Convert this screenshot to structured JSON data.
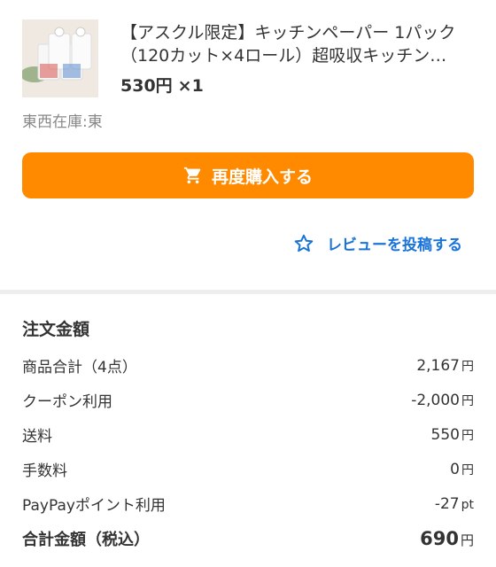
{
  "item": {
    "title_line1": "【アスクル限定】キッチンペーパー 1パック",
    "title_line2": "（120カット×4ロール）超吸収キッチン…",
    "price": "530円",
    "quantity": "×1",
    "image_icon": "paper-towel-product-image"
  },
  "warehouse": "東西在庫:東",
  "actions": {
    "rebuy_label": "再度購入する",
    "review_label": "レビューを投稿する"
  },
  "summary": {
    "title": "注文金額",
    "rows": [
      {
        "label": "商品合計（4点）",
        "value": "2,167",
        "unit": "円"
      },
      {
        "label": "クーポン利用",
        "value": "-2,000",
        "unit": "円"
      },
      {
        "label": "送料",
        "value": "550",
        "unit": "円"
      },
      {
        "label": "手数料",
        "value": "0",
        "unit": "円"
      },
      {
        "label": "PayPayポイント利用",
        "value": "-27",
        "unit": "pt"
      }
    ],
    "total": {
      "label": "合計金額（税込）",
      "value": "690",
      "unit": "円"
    }
  },
  "colors": {
    "accent": "#ff8a00",
    "link": "#1a73d9",
    "divider": "#eeeeee"
  }
}
